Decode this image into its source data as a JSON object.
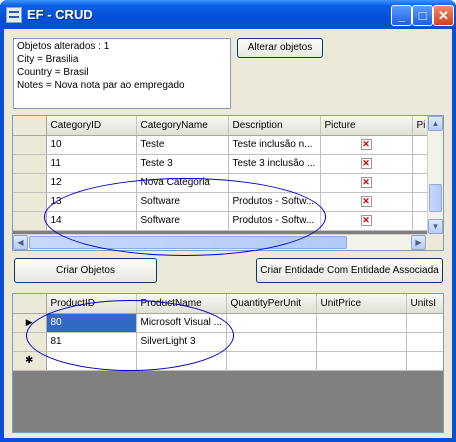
{
  "window": {
    "title": "EF - CRUD",
    "minimize": "_",
    "maximize": "□",
    "close": "✕"
  },
  "textbox": {
    "lines": [
      "Objetos alterados : 1",
      "City = Brasilia",
      "Country = Brasil",
      "Notes = Nova nota par ao empregado"
    ]
  },
  "buttons": {
    "alterar": "Alterar objetos",
    "criar": "Criar Objetos",
    "criar_assoc": "Criar Entidade Com Entidade Associada"
  },
  "categories_grid": {
    "columns": [
      "CategoryID",
      "CategoryName",
      "Description",
      "Picture",
      "Pi"
    ],
    "rows": [
      {
        "id": "10",
        "name": "Teste",
        "desc": "Teste inclusão n...",
        "picture_icon": "broken-image-icon"
      },
      {
        "id": "11",
        "name": "Teste 3",
        "desc": "Teste 3 inclusão ...",
        "picture_icon": "broken-image-icon"
      },
      {
        "id": "12",
        "name": "Nova Categoria",
        "desc": "",
        "picture_icon": "broken-image-icon"
      },
      {
        "id": "13",
        "name": "Software",
        "desc": "Produtos - Softw...",
        "picture_icon": "broken-image-icon"
      },
      {
        "id": "14",
        "name": "Software",
        "desc": "Produtos - Softw...",
        "picture_icon": "broken-image-icon"
      }
    ]
  },
  "products_grid": {
    "columns": [
      "ProductID",
      "ProductName",
      "QuantityPerUnit",
      "UnitPrice",
      "UnitsI"
    ],
    "rows": [
      {
        "id": "80",
        "name": "Microsoft Visual ...",
        "current": true
      },
      {
        "id": "81",
        "name": "SilverLight 3",
        "current": false
      }
    ],
    "new_row_marker": "✱",
    "current_row_marker": "▶"
  }
}
